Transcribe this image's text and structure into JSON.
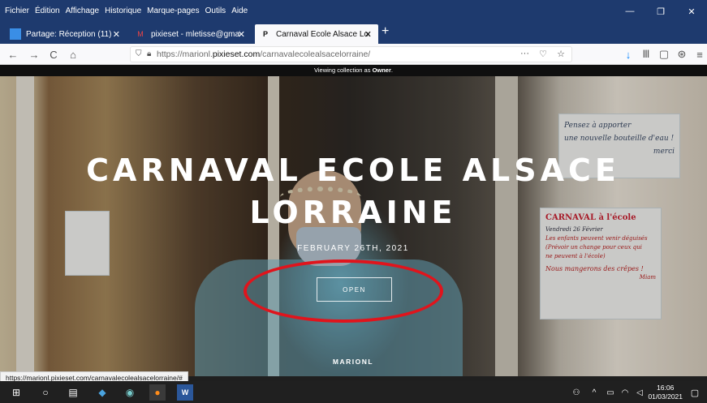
{
  "menu": [
    "Fichier",
    "Édition",
    "Affichage",
    "Historique",
    "Marque-pages",
    "Outils",
    "Aide"
  ],
  "window_controls": {
    "minimize": "—",
    "maximize": "❐",
    "close": "✕"
  },
  "tabs": [
    {
      "label": "Partage: Réception (11)",
      "icon": "outlook-icon",
      "close": "✕"
    },
    {
      "label": "pixieset - mletisse@gmail.com",
      "icon": "gmail-icon",
      "close": "✕"
    },
    {
      "label": "Carnaval Ecole Alsace Lorraine",
      "icon": "pixieset-icon",
      "close": "✕"
    }
  ],
  "new_tab": "+",
  "nav": {
    "back": "←",
    "forward": "→",
    "reload": "C",
    "home": "⌂",
    "url_prefix": "https://marionl.",
    "url_domain": "pixieset.com",
    "url_suffix": "/carnavalecolealsacelorraine/",
    "page_actions": "···",
    "pocket": "♡",
    "bookmark": "☆",
    "download": "↓",
    "library": "Ⅲ",
    "sidebar": "▢",
    "extension": "⊛",
    "menu": "≡"
  },
  "page": {
    "banner_prefix": "Viewing collection as ",
    "banner_role": "Owner",
    "banner_suffix": ".",
    "title": "CARNAVAL ECOLE ALSACE LORRAINE",
    "date": "FEBRUARY 26TH, 2021",
    "open_button": "OPEN",
    "author": "MARIONL",
    "annotation_color": "#e0141c"
  },
  "photo_notes": {
    "note1": [
      "Pensez à apporter",
      "une nouvelle bouteille d'eau !",
      "merci"
    ],
    "note2_title": "CARNAVAL à l'école",
    "note2_lines": [
      "Vendredi 26 Février",
      "Les enfants peuvent venir déguisés",
      "(Prévoir un change pour ceux qui",
      "ne peuvent à l'école)",
      "Nous mangerons des crêpes !",
      "Miam"
    ]
  },
  "status_link": "https://marionl.pixieset.com/carnavalecolealsacelorraine/#",
  "taskbar": {
    "time": "16:06",
    "date": "01/03/2021"
  }
}
